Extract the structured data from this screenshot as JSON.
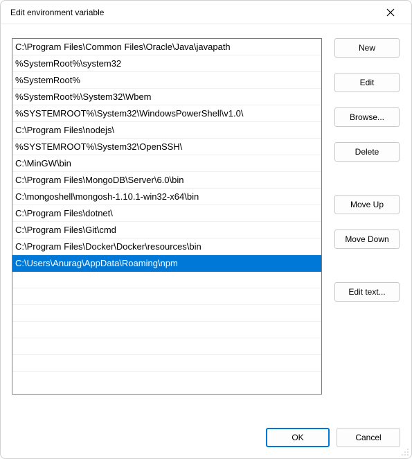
{
  "title": "Edit environment variable",
  "entries": [
    "C:\\Program Files\\Common Files\\Oracle\\Java\\javapath",
    "%SystemRoot%\\system32",
    "%SystemRoot%",
    "%SystemRoot%\\System32\\Wbem",
    "%SYSTEMROOT%\\System32\\WindowsPowerShell\\v1.0\\",
    "C:\\Program Files\\nodejs\\",
    "%SYSTEMROOT%\\System32\\OpenSSH\\",
    "C:\\MinGW\\bin",
    "C:\\Program Files\\MongoDB\\Server\\6.0\\bin",
    "C:\\mongoshell\\mongosh-1.10.1-win32-x64\\bin",
    "C:\\Program Files\\dotnet\\",
    "C:\\Program Files\\Git\\cmd",
    "C:\\Program Files\\Docker\\Docker\\resources\\bin",
    "C:\\Users\\Anurag\\AppData\\Roaming\\npm"
  ],
  "selected_index": 13,
  "buttons": {
    "new": "New",
    "edit": "Edit",
    "browse": "Browse...",
    "delete": "Delete",
    "move_up": "Move Up",
    "move_down": "Move Down",
    "edit_text": "Edit text...",
    "ok": "OK",
    "cancel": "Cancel"
  }
}
